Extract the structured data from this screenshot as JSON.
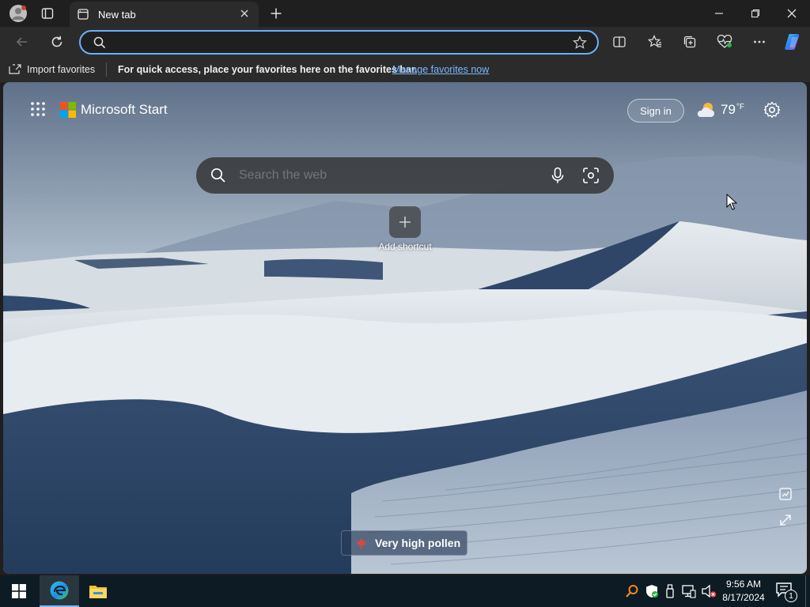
{
  "browser": {
    "tab": {
      "title": "New tab"
    },
    "address": {
      "value": ""
    },
    "favorites_bar": {
      "import_label": "Import favorites",
      "message": "For quick access, place your favorites here on the favorites bar.",
      "manage_link": "Manage favorites now"
    }
  },
  "start_page": {
    "brand": "Microsoft Start",
    "sign_in": "Sign in",
    "weather": {
      "temp": "79",
      "unit": "°F"
    },
    "search": {
      "placeholder": "Search the web"
    },
    "shortcut": {
      "label": "Add shortcut"
    },
    "pollen": {
      "label": "Very high pollen"
    }
  },
  "taskbar": {
    "time": "9:56 AM",
    "date": "8/17/2024",
    "notification_count": "1"
  },
  "colors": {
    "accent": "#6ab0ff",
    "link": "#7ab8ff",
    "pollen": "#e0443e"
  }
}
